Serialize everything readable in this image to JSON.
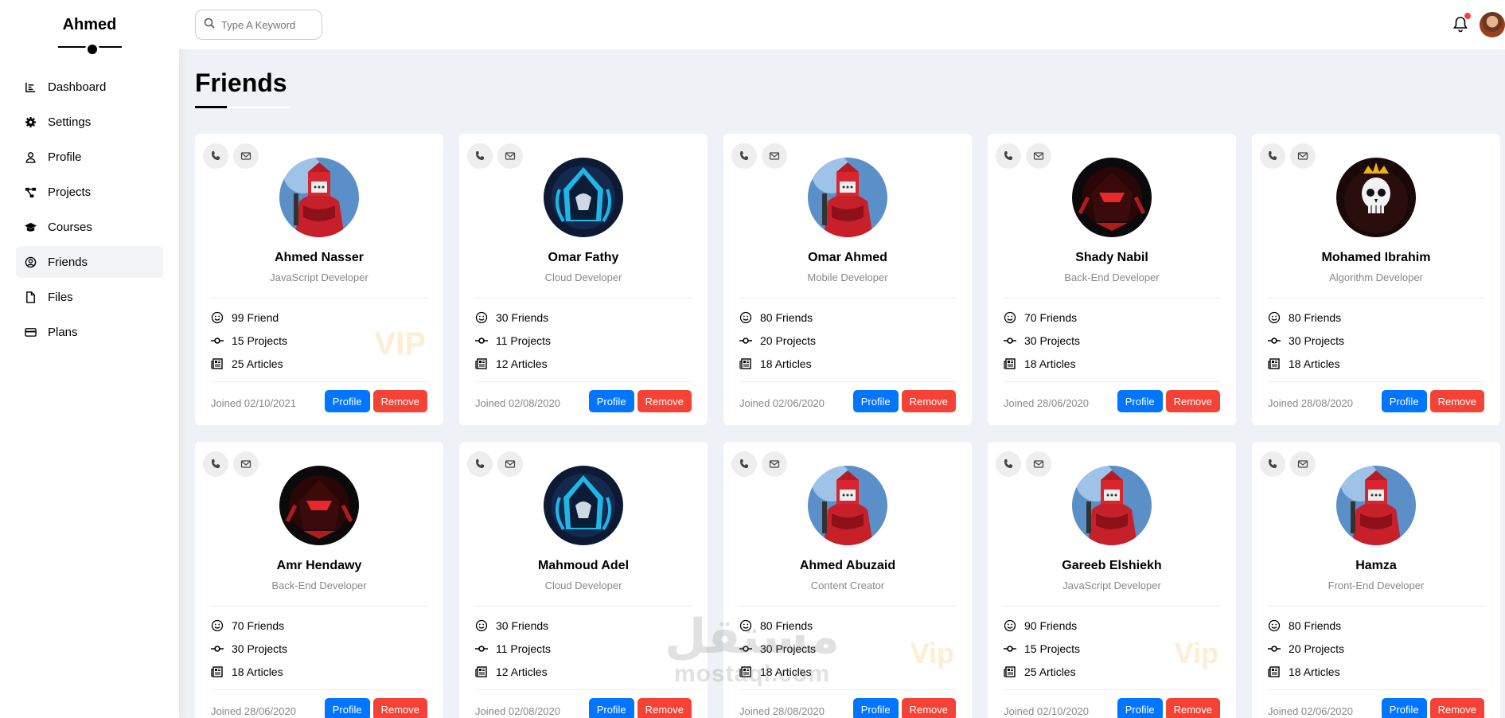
{
  "sidebar": {
    "brand": "Ahmed",
    "items": [
      {
        "label": "Dashboard",
        "icon": "chart-line-icon"
      },
      {
        "label": "Settings",
        "icon": "gear-icon"
      },
      {
        "label": "Profile",
        "icon": "user-icon"
      },
      {
        "label": "Projects",
        "icon": "diagram-project-icon"
      },
      {
        "label": "Courses",
        "icon": "graduation-cap-icon"
      },
      {
        "label": "Friends",
        "icon": "circle-user-icon",
        "active": true
      },
      {
        "label": "Files",
        "icon": "file-icon"
      },
      {
        "label": "Plans",
        "icon": "credit-card-icon"
      }
    ]
  },
  "header": {
    "search_placeholder": "Type A Keyword",
    "notification_icon": "bell-icon",
    "has_notification": true
  },
  "page": {
    "title": "Friends"
  },
  "friends": [
    {
      "name": "Ahmed Nasser",
      "role": "JavaScript Developer",
      "friends": "99 Friend",
      "projects": "15 Projects",
      "articles": "25 Articles",
      "joined": "Joined 02/10/2021",
      "vip": "VIP",
      "avatar": "red-warrior"
    },
    {
      "name": "Omar Fathy",
      "role": "Cloud Developer",
      "friends": "30 Friends",
      "projects": "11 Projects",
      "articles": "12 Articles",
      "joined": "Joined 02/08/2020",
      "vip": "",
      "avatar": "blue-hood"
    },
    {
      "name": "Omar Ahmed",
      "role": "Mobile Developer",
      "friends": "80 Friends",
      "projects": "20 Projects",
      "articles": "18 Articles",
      "joined": "Joined 02/06/2020",
      "vip": "",
      "avatar": "red-warrior"
    },
    {
      "name": "Shady Nabil",
      "role": "Back-End Developer",
      "friends": "70 Friends",
      "projects": "30 Projects",
      "articles": "18 Articles",
      "joined": "Joined 28/06/2020",
      "vip": "",
      "avatar": "red-ninja"
    },
    {
      "name": "Mohamed Ibrahim",
      "role": "Algorithm Developer",
      "friends": "80 Friends",
      "projects": "30 Projects",
      "articles": "18 Articles",
      "joined": "Joined 28/08/2020",
      "vip": "",
      "avatar": "crown-skull"
    },
    {
      "name": "Amr Hendawy",
      "role": "Back-End Developer",
      "friends": "70 Friends",
      "projects": "30 Projects",
      "articles": "18 Articles",
      "joined": "Joined 28/06/2020",
      "vip": "",
      "avatar": "red-ninja"
    },
    {
      "name": "Mahmoud Adel",
      "role": "Cloud Developer",
      "friends": "30 Friends",
      "projects": "11 Projects",
      "articles": "12 Articles",
      "joined": "Joined 02/08/2020",
      "vip": "",
      "avatar": "blue-hood"
    },
    {
      "name": "Ahmed Abuzaid",
      "role": "Content Creator",
      "friends": "80 Friends",
      "projects": "30 Projects",
      "articles": "18 Articles",
      "joined": "Joined 28/08/2020",
      "vip": "Vip",
      "avatar": "red-warrior"
    },
    {
      "name": "Gareeb Elshiekh",
      "role": "JavaScript Developer",
      "friends": "90 Friends",
      "projects": "15 Projects",
      "articles": "25 Articles",
      "joined": "Joined 02/10/2020",
      "vip": "Vip",
      "avatar": "red-warrior"
    },
    {
      "name": "Hamza",
      "role": "Front-End Developer",
      "friends": "80 Friends",
      "projects": "20 Projects",
      "articles": "18 Articles",
      "joined": "Joined 02/06/2020",
      "vip": "",
      "avatar": "red-warrior"
    }
  ],
  "card_labels": {
    "profile": "Profile",
    "remove": "Remove"
  },
  "watermark": {
    "arabic": "مستقل",
    "latin": "mostaql.com"
  },
  "colors": {
    "primary": "#0075ff",
    "danger": "#f44336",
    "background": "#eef1f5",
    "vip": "#fdeed4"
  }
}
